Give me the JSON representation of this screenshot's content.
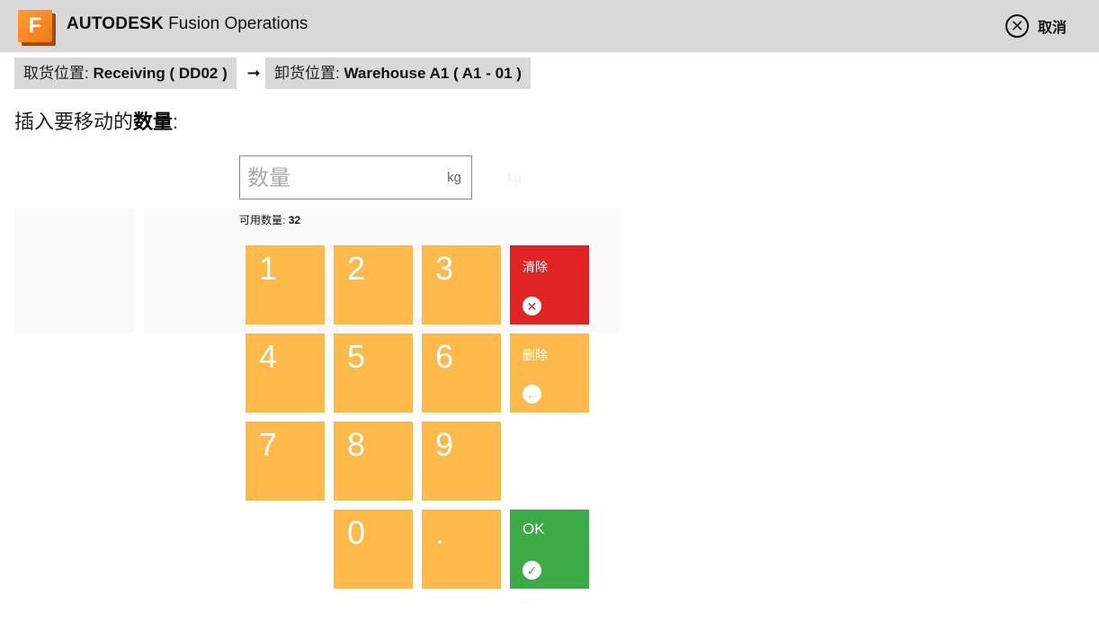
{
  "header": {
    "logo_letter": "F",
    "brand_bold": "AUTODESK",
    "brand_rest": " Fusion Operations",
    "cancel_icon": "close-circle-icon",
    "cancel_label": "取消"
  },
  "breadcrumb": {
    "from_label": "取货位置:",
    "from_value": "Receiving ( DD02 )",
    "arrow": "➞",
    "to_label": "卸货位置:",
    "to_value": "Warehouse A1 ( A1 - 01 )"
  },
  "prompt": {
    "text": "插入要移动的",
    "bold": "数量",
    "suffix": ":"
  },
  "quantity": {
    "placeholder": "数量",
    "value": "",
    "unit": "kg",
    "ghost_unit": "kg",
    "available_label": "可用数量:",
    "available_value": "32"
  },
  "keypad": {
    "k1": "1",
    "k2": "2",
    "k3": "3",
    "k4": "4",
    "k5": "5",
    "k6": "6",
    "k7": "7",
    "k8": "8",
    "k9": "9",
    "k0": "0",
    "kdot": ".",
    "clear_label": "清除",
    "clear_icon": "x-circle-icon",
    "delete_label": "删除",
    "delete_icon": "arrow-left-circle-icon",
    "ok_label": "OK",
    "ok_icon": "check-circle-icon"
  },
  "colors": {
    "key": "#fdb94a",
    "clear": "#e02424",
    "ok": "#3aab47",
    "header": "#d9d9d9"
  }
}
